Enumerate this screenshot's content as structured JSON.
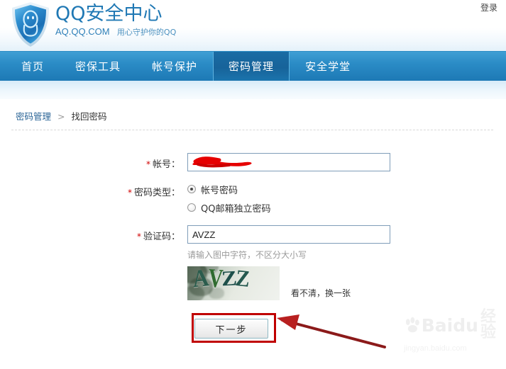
{
  "header": {
    "logo_icon": "qq-shield-penguin-icon",
    "brand_title": "QQ安全中心",
    "brand_domain": "AQ.QQ.COM",
    "brand_slogan": "用心守护你的QQ",
    "login_label": "登录"
  },
  "nav": {
    "items": [
      {
        "label": "首页",
        "active": false
      },
      {
        "label": "密保工具",
        "active": false
      },
      {
        "label": "帐号保护",
        "active": false
      },
      {
        "label": "密码管理",
        "active": true
      },
      {
        "label": "安全学堂",
        "active": false
      }
    ]
  },
  "breadcrumb": {
    "parent": "密码管理",
    "separator": ">",
    "current": "找回密码"
  },
  "form": {
    "account": {
      "required_mark": "*",
      "label": "帐号：",
      "value": "",
      "placeholder": "",
      "redacted": true,
      "redaction_color": "#e60000"
    },
    "password_type": {
      "required_mark": "*",
      "label": "密码类型：",
      "options": [
        {
          "label": "帐号密码",
          "selected": true
        },
        {
          "label": "QQ邮箱独立密码",
          "selected": false
        }
      ]
    },
    "captcha": {
      "required_mark": "*",
      "label": "验证码：",
      "value": "AVZZ",
      "placeholder": "",
      "hint": "请输入图中字符，不区分大小写",
      "image_text": "AVZZ",
      "refresh_label": "看不清，换一张"
    },
    "submit": {
      "label": "下一步"
    }
  },
  "annotation": {
    "box_color": "#c00000",
    "arrow_color": "#8b1a1a",
    "target": "next-step-button"
  },
  "watermark": {
    "brand": "Baidu",
    "suffix": "经验",
    "url": "jingyan.baidu.com"
  }
}
